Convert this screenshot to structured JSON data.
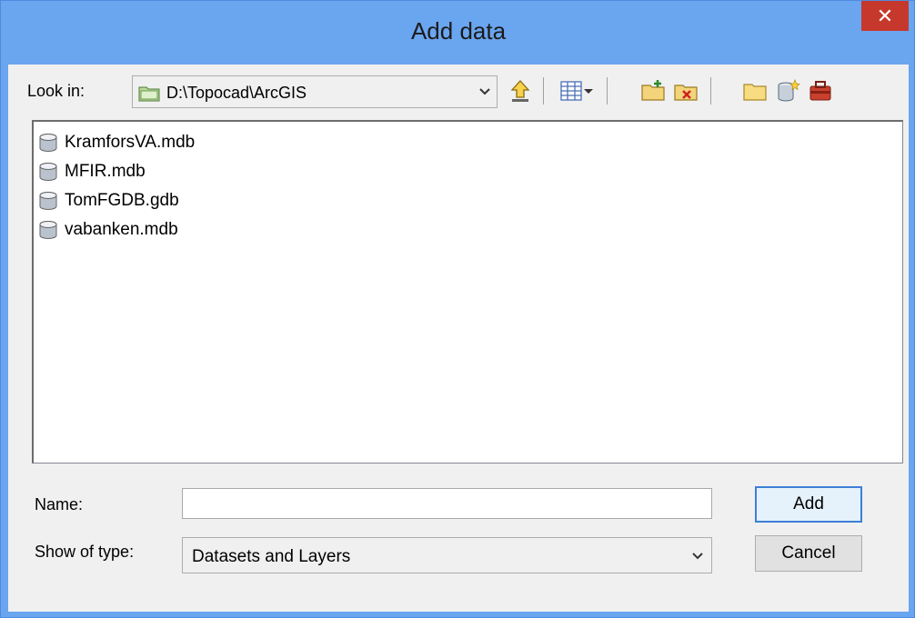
{
  "window": {
    "title": "Add data",
    "close_label": "✕"
  },
  "toolbar": {
    "look_in_label": "Look in:",
    "look_in_path": "D:\\Topocad\\ArcGIS",
    "icons": [
      "folder-up-icon",
      "list-view-icon",
      "connect-folder-icon",
      "disconnect-folder-icon",
      "new-folder-icon",
      "new-geodatabase-icon",
      "toolbox-icon"
    ]
  },
  "file_list": {
    "items": [
      {
        "name": "KramforsVA.mdb",
        "icon": "geodatabase-icon"
      },
      {
        "name": "MFIR.mdb",
        "icon": "geodatabase-icon"
      },
      {
        "name": "TomFGDB.gdb",
        "icon": "geodatabase-icon"
      },
      {
        "name": "vabanken.mdb",
        "icon": "geodatabase-icon"
      }
    ]
  },
  "form": {
    "name_label": "Name:",
    "name_value": "",
    "type_label": "Show of type:",
    "type_value": "Datasets and Layers"
  },
  "buttons": {
    "add_label": "Add",
    "cancel_label": "Cancel"
  },
  "colors": {
    "titlebar": "#6aa5f0",
    "close": "#c7382c",
    "default_border": "#3c7fd8"
  }
}
